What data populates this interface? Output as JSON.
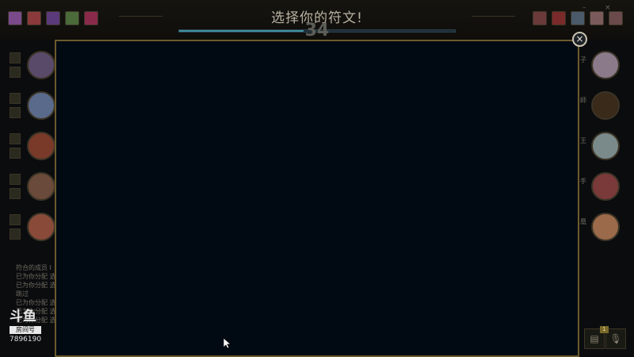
{
  "header": {
    "title": "选择你的符文!",
    "timer": "34",
    "timer_progress": 0.45
  },
  "window_controls": {
    "minimize": "–",
    "close": "×"
  },
  "blue_team": {
    "bans": [
      {
        "color": "#7a4a8a"
      },
      {
        "color": "#8a3a3a"
      },
      {
        "color": "#5a3a7a"
      },
      {
        "color": "#4a6a3a"
      },
      {
        "color": "#8a2a4a"
      }
    ],
    "players": [
      {
        "portrait_color": "#5a4a6a"
      },
      {
        "portrait_color": "#5a6a8a"
      },
      {
        "portrait_color": "#7a3a2a"
      },
      {
        "portrait_color": "#6a4a3a"
      },
      {
        "portrait_color": "#8a4a3a"
      }
    ]
  },
  "red_team": {
    "bans": [
      {
        "color": "#6a3a3a"
      },
      {
        "color": "#7a2a2a"
      },
      {
        "color": "#4a5a6a"
      },
      {
        "color": "#7a5a5a"
      },
      {
        "color": "#6a4a4a"
      }
    ],
    "players": [
      {
        "name_frag": "子",
        "portrait_color": "#8a7a8a"
      },
      {
        "name_frag": "師",
        "portrait_color": "#3a2a1a"
      },
      {
        "name_frag": "王",
        "portrait_color": "#7a8a8a"
      },
      {
        "name_frag": "手",
        "portrait_color": "#7a3a3a"
      },
      {
        "name_frag": "凰",
        "portrait_color": "#9a6a4a"
      }
    ]
  },
  "chat": {
    "lines": [
      "符合的成员 I",
      "已为你分配 选",
      "已为你分配 选",
      "跳过",
      "已为你分配 选",
      "已为你分配 选",
      "已为你分配 选"
    ]
  },
  "watermark": {
    "logo": "斗鱼",
    "room_label": "房间号",
    "room_number": "7896190"
  },
  "bottom_right": {
    "badge": "1"
  },
  "modal": {
    "close_label": "×",
    "background": "#010a13",
    "border": "#6b5a2c"
  }
}
